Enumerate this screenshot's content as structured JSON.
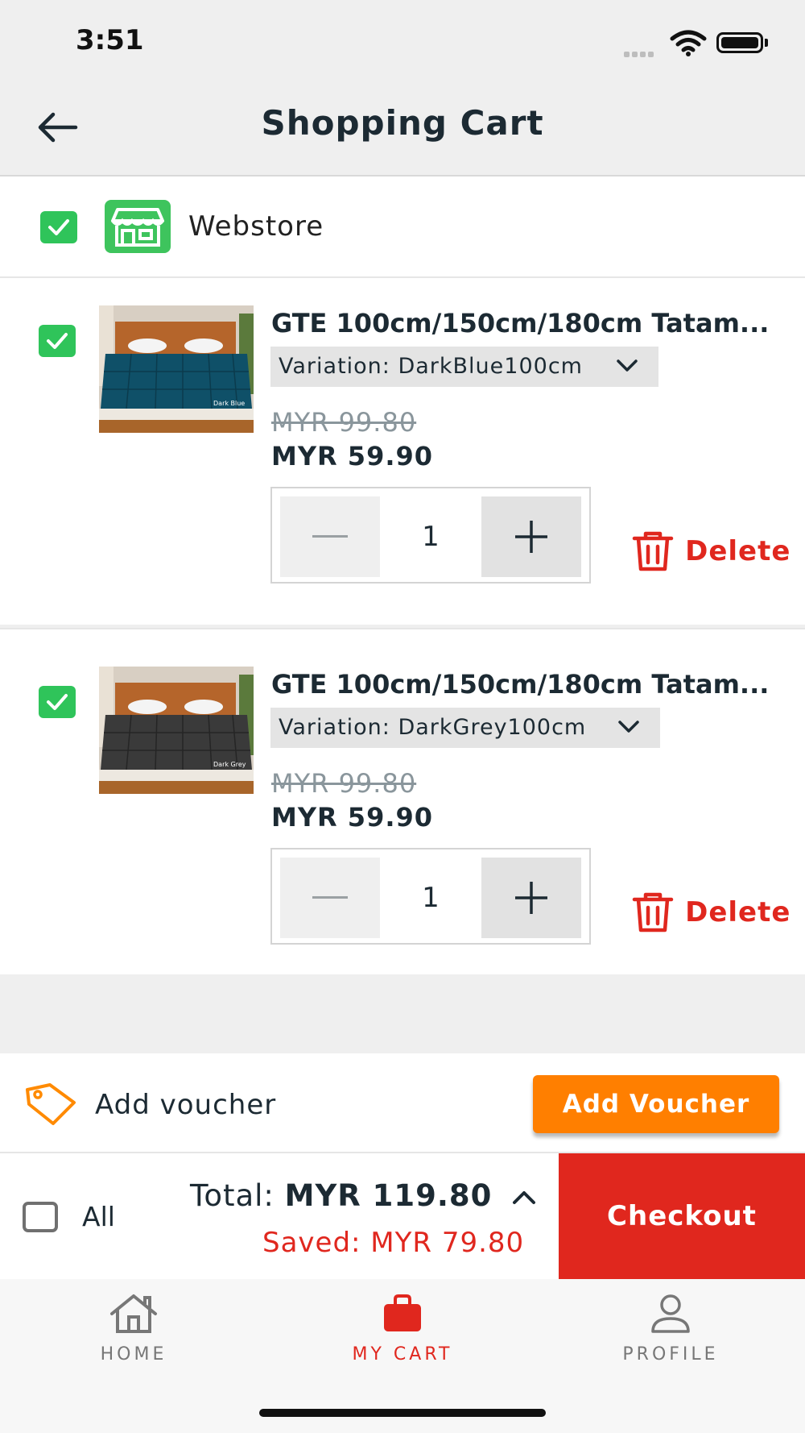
{
  "status_bar": {
    "time": "3:51"
  },
  "header": {
    "title": "Shopping Cart"
  },
  "store": {
    "name": "Webstore"
  },
  "items": [
    {
      "name": "GTE 100cm/150cm/180cm Tatam...",
      "variation": "Variation: DarkBlue100cm",
      "old_price": "MYR 99.80",
      "price": "MYR 59.90",
      "quantity": "1",
      "delete_label": "Delete",
      "thumb_label": "Dark Blue",
      "thumb_color": "#0f5068"
    },
    {
      "name": "GTE 100cm/150cm/180cm Tatam...",
      "variation": "Variation: DarkGrey100cm",
      "old_price": "MYR 99.80",
      "price": "MYR 59.90",
      "quantity": "1",
      "delete_label": "Delete",
      "thumb_label": "Dark Grey",
      "thumb_color": "#3a3a3a"
    }
  ],
  "voucher": {
    "label": "Add voucher",
    "button": "Add Voucher"
  },
  "summary": {
    "all_label": "All",
    "total_prefix": "Total:",
    "total_value": "MYR 119.80",
    "saved": "Saved: MYR 79.80",
    "checkout": "Checkout"
  },
  "tabs": [
    {
      "label": "HOME",
      "icon": "home-icon",
      "active": false
    },
    {
      "label": "MY CART",
      "icon": "bag-icon",
      "active": true
    },
    {
      "label": "PROFILE",
      "icon": "person-icon",
      "active": false
    }
  ],
  "colors": {
    "accent_red": "#e0271e",
    "checkbox_green": "#2fc45a",
    "voucher_orange": "#ff7f00"
  }
}
